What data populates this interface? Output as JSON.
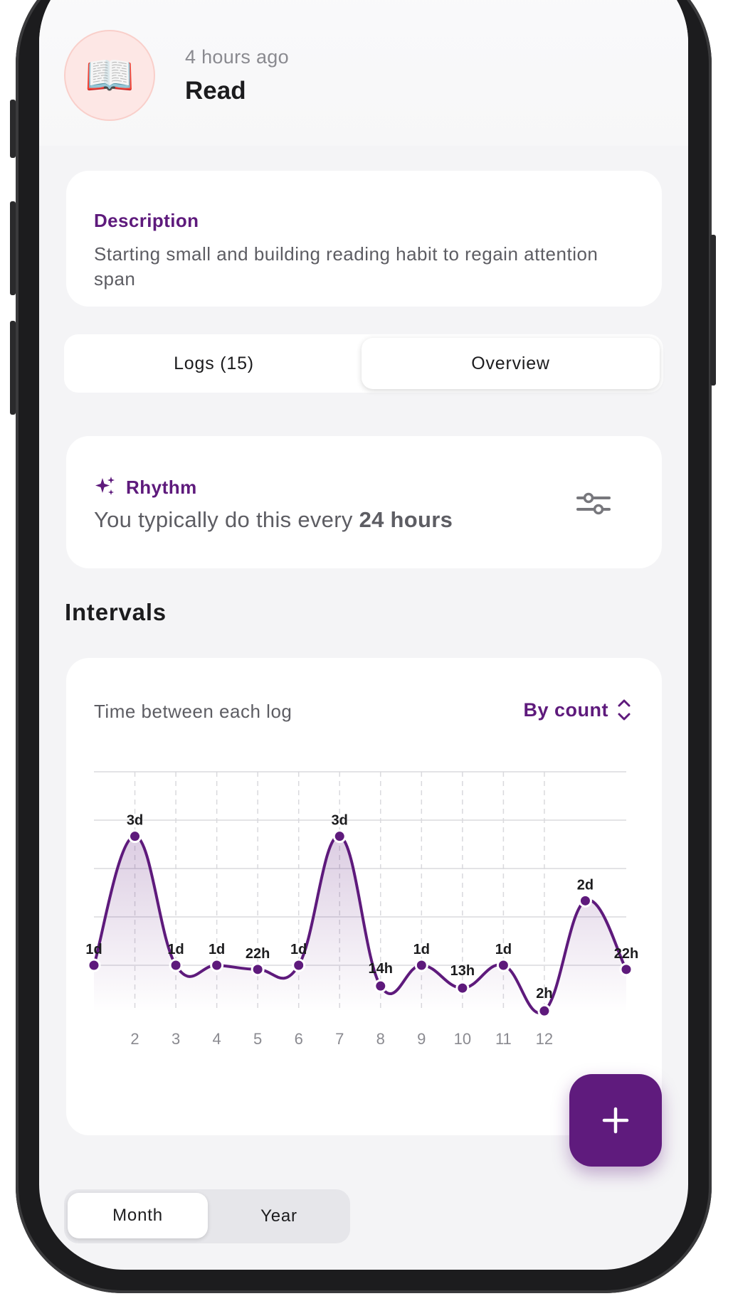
{
  "header": {
    "time_ago": "4 hours ago",
    "habit_name": "Read",
    "avatar_emoji": "📖"
  },
  "description": {
    "label": "Description",
    "text": "Starting small and building reading habit to regain attention span"
  },
  "tabs": [
    {
      "label": "Logs (15)",
      "active": false
    },
    {
      "label": "Overview",
      "active": true
    }
  ],
  "rhythm": {
    "label": "Rhythm",
    "prefix": "You typically do this every ",
    "value": "24 hours",
    "icon": "sparkles-icon",
    "settings_icon": "sliders-icon"
  },
  "intervals": {
    "title": "Intervals",
    "subtitle": "Time between each log",
    "sort_label": "By count"
  },
  "chart_data": {
    "type": "line",
    "x": [
      1,
      2,
      3,
      4,
      5,
      6,
      7,
      8,
      9,
      10,
      11,
      12,
      13,
      14
    ],
    "x_tick_labels": [
      "2",
      "3",
      "4",
      "5",
      "6",
      "7",
      "8",
      "9",
      "10",
      "11",
      "12"
    ],
    "values_hours": [
      24,
      72,
      24,
      24,
      22,
      24,
      72,
      14,
      24,
      13,
      24,
      2,
      48,
      22
    ],
    "value_labels": [
      "1d",
      "3d",
      "1d",
      "1d",
      "22h",
      "1d",
      "3d",
      "14h",
      "1d",
      "13h",
      "1d",
      "2h",
      "2d",
      "22h"
    ],
    "grid": true,
    "area_fill": true,
    "color": "#5e1a7c"
  },
  "range_tabs": [
    {
      "label": "Month",
      "active": true
    },
    {
      "label": "Year",
      "active": false
    }
  ],
  "colors": {
    "accent": "#5e1a7c",
    "background": "#f4f4f6",
    "card": "#ffffff"
  }
}
